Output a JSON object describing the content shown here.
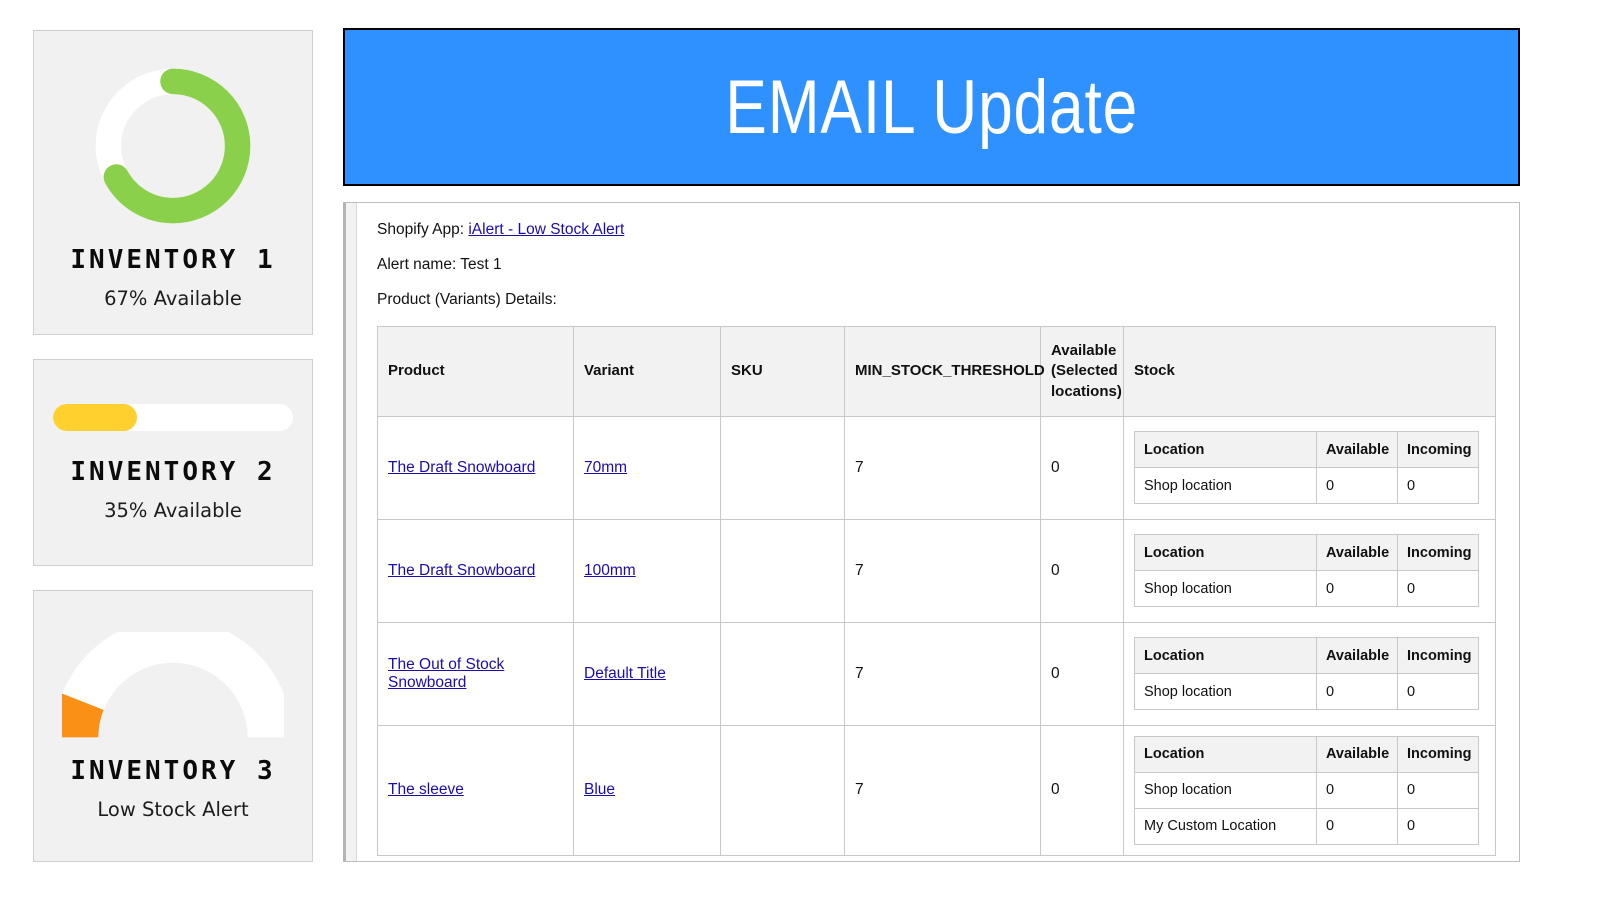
{
  "colors": {
    "banner_bg": "#2f90ff",
    "card_bg": "#f1f1f1",
    "donut_green": "#8bd04a",
    "bar_yellow": "#ffd02e",
    "gauge_orange": "#fa9016",
    "track_white": "#ffffff",
    "link_blue": "#1a0dab"
  },
  "inventory_cards": [
    {
      "viz": "donut-chart-icon",
      "title": "INVENTORY 1",
      "subtitle": "67% Available",
      "percent": 67,
      "color": "#8bd04a"
    },
    {
      "viz": "progress-bar-icon",
      "title": "INVENTORY 2",
      "subtitle": "35% Available",
      "percent": 35,
      "color": "#ffd02e"
    },
    {
      "viz": "gauge-icon",
      "title": "INVENTORY 3",
      "subtitle": "Low Stock Alert",
      "percent": 12,
      "color": "#fa9016"
    }
  ],
  "banner": {
    "title": "EMAIL Update"
  },
  "email": {
    "shopify_app_label": "Shopify App:",
    "shopify_app_link": "iAlert - Low Stock Alert",
    "alert_name_line": "Alert name: Test 1",
    "product_details_line": "Product (Variants) Details:",
    "table": {
      "headers": [
        "Product",
        "Variant",
        "SKU",
        "MIN_STOCK_THRESHOLD",
        "Available (Selected locations)",
        "Stock"
      ],
      "stock_headers": [
        "Location",
        "Available",
        "Incoming"
      ],
      "rows": [
        {
          "product": "The Draft Snowboard",
          "variant": "70mm",
          "sku": "",
          "min_stock_threshold": "7",
          "available_selected": "0",
          "stock": [
            {
              "location": "Shop location",
              "available": "0",
              "incoming": "0"
            }
          ]
        },
        {
          "product": "The Draft Snowboard",
          "variant": "100mm",
          "sku": "",
          "min_stock_threshold": "7",
          "available_selected": "0",
          "stock": [
            {
              "location": "Shop location",
              "available": "0",
              "incoming": "0"
            }
          ]
        },
        {
          "product": "The Out of Stock Snowboard",
          "variant": "Default Title",
          "sku": "",
          "min_stock_threshold": "7",
          "available_selected": "0",
          "stock": [
            {
              "location": "Shop location",
              "available": "0",
              "incoming": "0"
            }
          ]
        },
        {
          "product": "The sleeve",
          "variant": "Blue",
          "sku": "",
          "min_stock_threshold": "7",
          "available_selected": "0",
          "stock": [
            {
              "location": "Shop location",
              "available": "0",
              "incoming": "0"
            },
            {
              "location": "My Custom Location",
              "available": "0",
              "incoming": "0"
            }
          ]
        }
      ]
    }
  }
}
